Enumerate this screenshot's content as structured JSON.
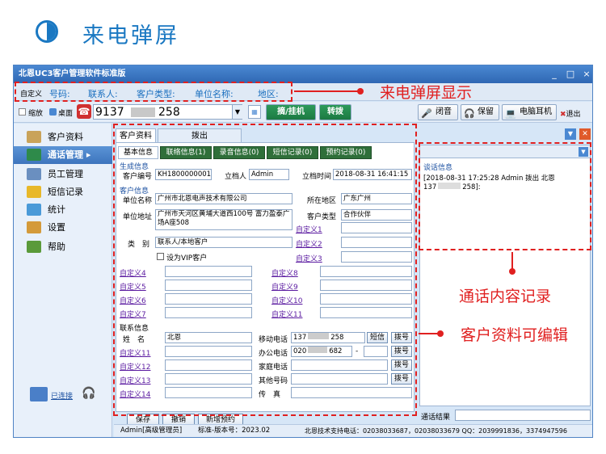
{
  "page": {
    "title": "来电弹屏"
  },
  "window": {
    "title": "北恩UC3客户管理软件标准版",
    "min": "_",
    "max": "□",
    "close": "×"
  },
  "infobar": {
    "custom": "自定义",
    "number": "号码:",
    "contact": "联系人:",
    "cust_type": "客户类型:",
    "unit": "单位名称:",
    "region": "地区:"
  },
  "toolbar": {
    "shrink": "缩放",
    "desktop": "桌面",
    "phone": "9137",
    "phone_tail": "258",
    "answer": "摘/挂机",
    "transfer": "转拨",
    "mute": "闭音",
    "hold": "保留",
    "headset": "电脑耳机",
    "exit": "退出"
  },
  "sidebar": {
    "items": [
      {
        "label": "客户资料"
      },
      {
        "label": "通话管理"
      },
      {
        "label": "员工管理"
      },
      {
        "label": "短信记录"
      },
      {
        "label": "统计"
      },
      {
        "label": "设置"
      },
      {
        "label": "帮助"
      }
    ],
    "connected": "已连接"
  },
  "tabs": {
    "top": [
      "客户资料",
      "拨出[KH1800000001]"
    ],
    "sub": [
      "基本信息",
      "联络信息(1)",
      "录音信息(0)",
      "短信记录(0)",
      "预约记录(0)"
    ]
  },
  "form": {
    "sec_gen": "生成信息",
    "sec_cust": "客户信息",
    "sec_contact": "联系信息",
    "cust_no_l": "客户编号",
    "cust_no": "KH1800000001",
    "creator_l": "立档人",
    "creator": "Admin",
    "time_l": "立档时间",
    "time": "2018-08-31 16:41:15",
    "unit_l": "单位名称",
    "unit": "广州市北恩电声技术有限公司",
    "region_l": "所在地区",
    "region": "广东广州",
    "addr_l": "单位地址",
    "addr": "广州市天河区黄埔大道西100号 富力盈泰广场A座508",
    "type_l": "客户类型",
    "type": "合作伙伴",
    "cat_l": "类　别",
    "cat": "联系人/本地客户",
    "vip": "设为VIP客户",
    "c1": "自定义1",
    "c2": "自定义2",
    "c3": "自定义3",
    "c4": "自定义4",
    "c5": "自定义5",
    "c6": "自定义6",
    "c7": "自定义7",
    "c8": "自定义8",
    "c9": "自定义9",
    "c10": "自定义10",
    "c11": "自定义11",
    "name_l": "姓　名",
    "name": "北恩",
    "mobile_l": "移动电话",
    "mobile": "137",
    "mobile_tail": "258",
    "sms": "短信",
    "dial": "拨号",
    "office_l": "办公电话",
    "office": "020",
    "office_tail": "682",
    "dash": "-",
    "c11b": "自定义11",
    "c12": "自定义12",
    "c13": "自定义13",
    "c14": "自定义14",
    "home_l": "家庭电话",
    "other_l": "其他号码",
    "fax_l": "传　真",
    "save": "保存",
    "undo": "撤销",
    "newapt": "新增预约"
  },
  "right": {
    "sec": "谈话信息",
    "log": "[2018-08-31 17:25:28 Admin 拨出 北恩",
    "log2": "137",
    "log2_tail": "258]:",
    "result": "通话结果"
  },
  "status": {
    "user": "Admin[高级管理员]",
    "ver": "标准-版本号：2023.02",
    "support": "北恩技术支持电话：02038033687，02038033679 QQ：2039991836，3374947596"
  },
  "annotations": {
    "popup": "来电弹屏显示",
    "record": "通话内容记录",
    "edit": "客户资料可编辑"
  }
}
